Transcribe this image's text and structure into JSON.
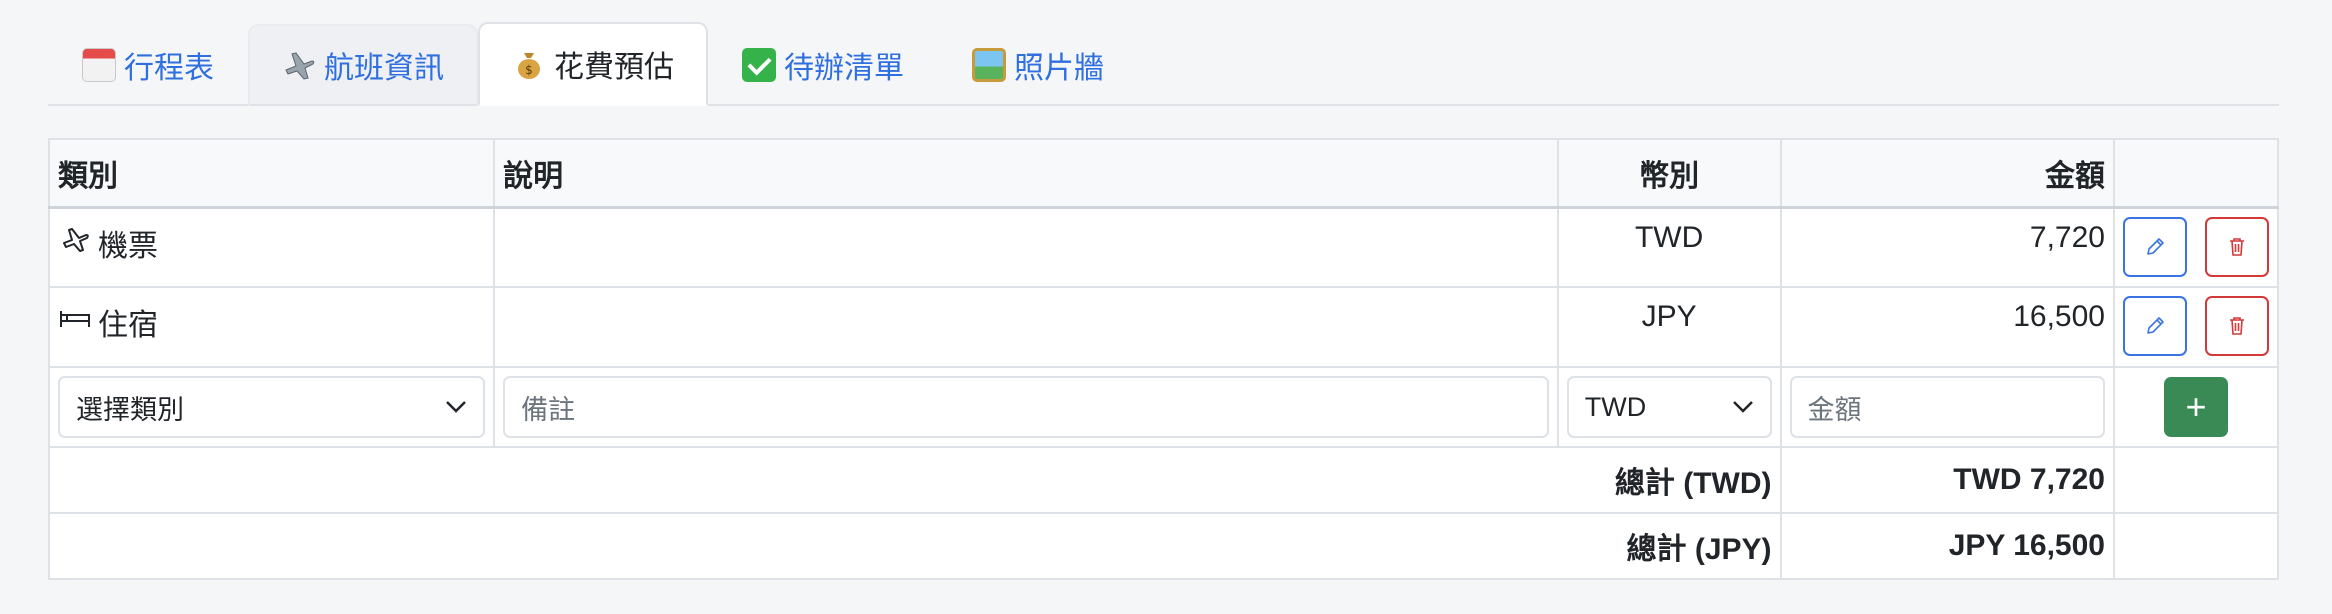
{
  "tabs": [
    {
      "label": "行程表",
      "icon": "calendar-icon"
    },
    {
      "label": "航班資訊",
      "icon": "airplane-icon"
    },
    {
      "label": "花費預估",
      "icon": "money-bag-icon"
    },
    {
      "label": "待辦清單",
      "icon": "check-mark-icon"
    },
    {
      "label": "照片牆",
      "icon": "framed-picture-icon"
    }
  ],
  "active_tab": "花費預估",
  "table": {
    "headers": {
      "category": "類別",
      "description": "說明",
      "currency": "幣別",
      "amount": "金額"
    },
    "rows": [
      {
        "icon": "airplane-icon",
        "category": "機票",
        "description": "",
        "currency": "TWD",
        "amount": "7,720"
      },
      {
        "icon": "bed-icon",
        "category": "住宿",
        "description": "",
        "currency": "JPY",
        "amount": "16,500"
      }
    ],
    "new_row": {
      "category_placeholder": "選擇類別",
      "note_placeholder": "備註",
      "currency_value": "TWD",
      "amount_placeholder": "金額",
      "add_label": "+"
    },
    "totals": [
      {
        "label": "總計 (TWD)",
        "value": "TWD 7,720"
      },
      {
        "label": "總計 (JPY)",
        "value": "JPY 16,500"
      }
    ]
  },
  "colors": {
    "link": "#2f6fe0",
    "edit": "#3b73e0",
    "delete": "#d23a3a",
    "add": "#3a8a56"
  }
}
